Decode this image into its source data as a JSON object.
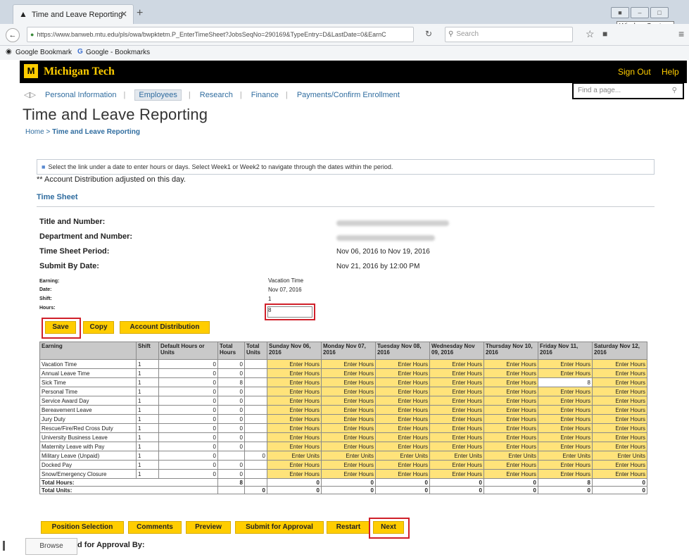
{
  "browser": {
    "tab_title": "Time and Leave Reporting",
    "url": "https://www.banweb.mtu.edu/pls/owa/bwpktetm.P_EnterTimeSheet?JobsSeqNo=290169&TypeEntry=D&LastDate=0&EarnC",
    "search_placeholder": "Search",
    "tooltip": "Window Capture",
    "bookmarks": [
      "Google Bookmark",
      "Google - Bookmarks"
    ]
  },
  "header": {
    "brand": "Michigan Tech",
    "sign_out": "Sign Out",
    "help": "Help",
    "find_placeholder": "Find a page..."
  },
  "menu": [
    "Personal Information",
    "Employees",
    "Research",
    "Finance",
    "Payments/Confirm Enrollment"
  ],
  "page": {
    "title": "Time and Leave Reporting",
    "breadcrumb_home": "Home",
    "breadcrumb_current": "Time and Leave Reporting",
    "info": "Select the link under a date to enter hours or days. Select Week1 or Week2 to navigate through the dates within the period.",
    "note": "** Account Distribution adjusted on this day.",
    "section": "Time Sheet"
  },
  "details": {
    "title_label": "Title and Number:",
    "dept_label": "Department and Number:",
    "period_label": "Time Sheet Period:",
    "period_value": "Nov 06, 2016 to Nov 19, 2016",
    "submit_label": "Submit By Date:",
    "submit_value": "Nov 21, 2016 by 12:00 PM"
  },
  "entry": {
    "earning_label": "Earning:",
    "earning_value": "Vacation Time",
    "date_label": "Date:",
    "date_value": "Nov 07, 2016",
    "shift_label": "Shift:",
    "shift_value": "1",
    "hours_label": "Hours:",
    "hours_value": "8"
  },
  "buttons": {
    "save": "Save",
    "copy": "Copy",
    "account_distribution": "Account Distribution",
    "position_selection": "Position Selection",
    "comments": "Comments",
    "preview": "Preview",
    "submit": "Submit for Approval",
    "restart": "Restart",
    "next": "Next",
    "browse": "Browse"
  },
  "approval_text": "d for Approval By:",
  "table": {
    "headers": [
      "Earning",
      "Shift",
      "Default Hours or Units",
      "Total Hours",
      "Total Units",
      "Sunday Nov 06, 2016",
      "Monday Nov 07, 2016",
      "Tuesday Nov 08, 2016",
      "Wednesday Nov 09, 2016",
      "Thursday Nov 10, 2016",
      "Friday Nov 11, 2016",
      "Saturday Nov 12, 2016"
    ],
    "rows": [
      [
        "Vacation Time",
        "1",
        "0",
        "0",
        "",
        "Enter Hours",
        "Enter Hours",
        "Enter Hours",
        "Enter Hours",
        "Enter Hours",
        "Enter Hours",
        "Enter Hours"
      ],
      [
        "Annual Leave Time",
        "1",
        "0",
        "0",
        "",
        "Enter Hours",
        "Enter Hours",
        "Enter Hours",
        "Enter Hours",
        "Enter Hours",
        "Enter Hours",
        "Enter Hours"
      ],
      [
        "Sick Time",
        "1",
        "0",
        "8",
        "",
        "Enter Hours",
        "Enter Hours",
        "Enter Hours",
        "Enter Hours",
        "Enter Hours",
        "8",
        "Enter Hours"
      ],
      [
        "Personal Time",
        "1",
        "0",
        "0",
        "",
        "Enter Hours",
        "Enter Hours",
        "Enter Hours",
        "Enter Hours",
        "Enter Hours",
        "Enter Hours",
        "Enter Hours"
      ],
      [
        "Service Award Day",
        "1",
        "0",
        "0",
        "",
        "Enter Hours",
        "Enter Hours",
        "Enter Hours",
        "Enter Hours",
        "Enter Hours",
        "Enter Hours",
        "Enter Hours"
      ],
      [
        "Bereavement Leave",
        "1",
        "0",
        "0",
        "",
        "Enter Hours",
        "Enter Hours",
        "Enter Hours",
        "Enter Hours",
        "Enter Hours",
        "Enter Hours",
        "Enter Hours"
      ],
      [
        "Jury Duty",
        "1",
        "0",
        "0",
        "",
        "Enter Hours",
        "Enter Hours",
        "Enter Hours",
        "Enter Hours",
        "Enter Hours",
        "Enter Hours",
        "Enter Hours"
      ],
      [
        "Rescue/Fire/Red Cross Duty",
        "1",
        "0",
        "0",
        "",
        "Enter Hours",
        "Enter Hours",
        "Enter Hours",
        "Enter Hours",
        "Enter Hours",
        "Enter Hours",
        "Enter Hours"
      ],
      [
        "University Business Leave",
        "1",
        "0",
        "0",
        "",
        "Enter Hours",
        "Enter Hours",
        "Enter Hours",
        "Enter Hours",
        "Enter Hours",
        "Enter Hours",
        "Enter Hours"
      ],
      [
        "Maternity Leave with Pay",
        "1",
        "0",
        "0",
        "",
        "Enter Hours",
        "Enter Hours",
        "Enter Hours",
        "Enter Hours",
        "Enter Hours",
        "Enter Hours",
        "Enter Hours"
      ],
      [
        "Military Leave (Unpaid)",
        "1",
        "0",
        "",
        "0",
        "Enter Units",
        "Enter Units",
        "Enter Units",
        "Enter Units",
        "Enter Units",
        "Enter Units",
        "Enter Units"
      ],
      [
        "Docked Pay",
        "1",
        "0",
        "0",
        "",
        "Enter Hours",
        "Enter Hours",
        "Enter Hours",
        "Enter Hours",
        "Enter Hours",
        "Enter Hours",
        "Enter Hours"
      ],
      [
        "Snow/Emergency Closure",
        "1",
        "0",
        "0",
        "",
        "Enter Hours",
        "Enter Hours",
        "Enter Hours",
        "Enter Hours",
        "Enter Hours",
        "Enter Hours",
        "Enter Hours"
      ]
    ],
    "total_hours": [
      "Total Hours:",
      "8",
      "",
      "0",
      "0",
      "0",
      "0",
      "0",
      "8",
      "0"
    ],
    "total_units": [
      "Total Units:",
      "",
      "0",
      "0",
      "0",
      "0",
      "0",
      "0",
      "0",
      "0"
    ]
  }
}
